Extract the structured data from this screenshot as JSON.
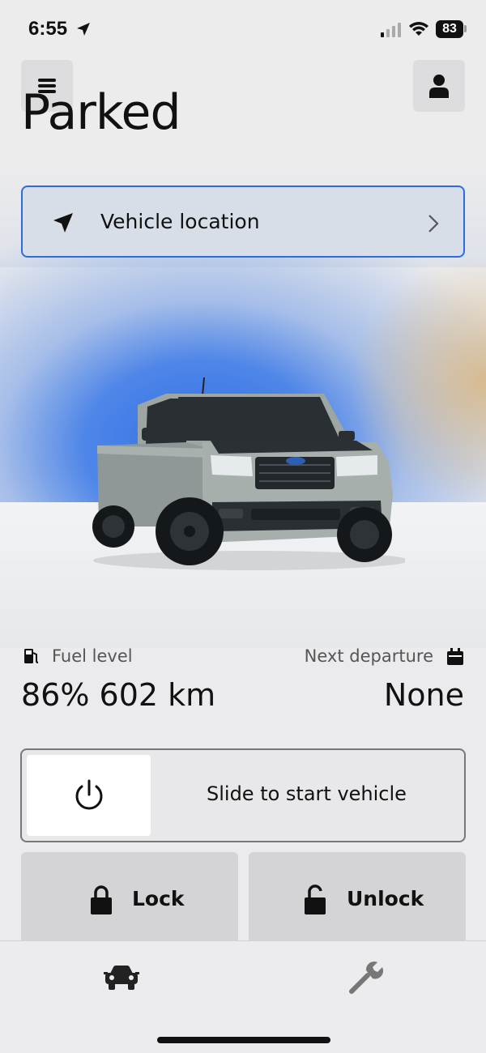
{
  "status_bar": {
    "time": "6:55",
    "battery": "83"
  },
  "header": {
    "title": "Parked"
  },
  "vehicle_location": {
    "label": "Vehicle location"
  },
  "stats": {
    "fuel_label": "Fuel level",
    "fuel_value": "86% 602 km",
    "departure_label": "Next departure",
    "departure_value": "None"
  },
  "start_slider": {
    "label": "Slide to start vehicle"
  },
  "actions": {
    "lock_label": "Lock",
    "unlock_label": "Unlock"
  },
  "tabs": [
    {
      "icon": "car-icon"
    },
    {
      "icon": "wrench-icon"
    }
  ],
  "colors": {
    "accent": "#2d6be0",
    "hero_blue": "#2f6fe4",
    "hero_sand": "#d6b98c"
  }
}
